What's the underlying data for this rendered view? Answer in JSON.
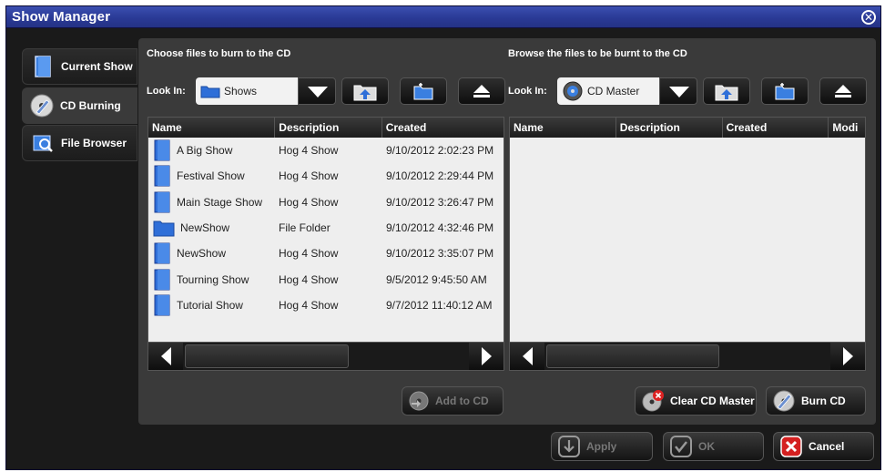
{
  "window": {
    "title": "Show Manager"
  },
  "tabs": [
    {
      "label": "Current Show",
      "icon": "current-show-icon",
      "active": false
    },
    {
      "label": "CD Burning",
      "icon": "cd-burning-icon",
      "active": true
    },
    {
      "label": "File Browser",
      "icon": "file-browser-icon",
      "active": false
    }
  ],
  "left_pane": {
    "caption": "Choose files to burn to the CD",
    "look_in_label": "Look In:",
    "look_in_value": "Shows",
    "columns": [
      "Name",
      "Description",
      "Created"
    ],
    "rows": [
      {
        "icon": "show-file-icon",
        "name": "A Big Show",
        "description": "Hog 4 Show",
        "created": "9/10/2012 2:02:23 PM"
      },
      {
        "icon": "show-file-icon",
        "name": "Festival Show",
        "description": "Hog 4 Show",
        "created": "9/10/2012 2:29:44 PM"
      },
      {
        "icon": "show-file-icon",
        "name": "Main Stage Show",
        "description": "Hog 4 Show",
        "created": "9/10/2012 3:26:47 PM"
      },
      {
        "icon": "folder-icon",
        "name": "NewShow",
        "description": "File Folder",
        "created": "9/10/2012 4:32:46 PM"
      },
      {
        "icon": "show-file-icon",
        "name": "NewShow",
        "description": "Hog 4 Show",
        "created": "9/10/2012 3:35:07 PM"
      },
      {
        "icon": "show-file-icon",
        "name": "Tourning Show",
        "description": "Hog 4 Show",
        "created": "9/5/2012 9:45:50 AM"
      },
      {
        "icon": "show-file-icon",
        "name": "Tutorial Show",
        "description": "Hog 4 Show",
        "created": "9/7/2012 11:40:12 AM"
      }
    ],
    "add_to_cd_label": "Add to CD"
  },
  "right_pane": {
    "caption": "Browse the files to be burnt to the CD",
    "look_in_label": "Look In:",
    "look_in_value": "CD Master",
    "columns": [
      "Name",
      "Description",
      "Created",
      "Modi"
    ],
    "clear_cd_master_label": "Clear CD Master",
    "burn_cd_label": "Burn CD"
  },
  "footer": {
    "apply_label": "Apply",
    "ok_label": "OK",
    "cancel_label": "Cancel"
  },
  "colors": {
    "titlebar": "#2f3fa0",
    "background": "#1a1a1a",
    "panel": "#3a3a3a",
    "list_bg": "#eeeeee",
    "folder_blue": "#2f6fd8"
  }
}
